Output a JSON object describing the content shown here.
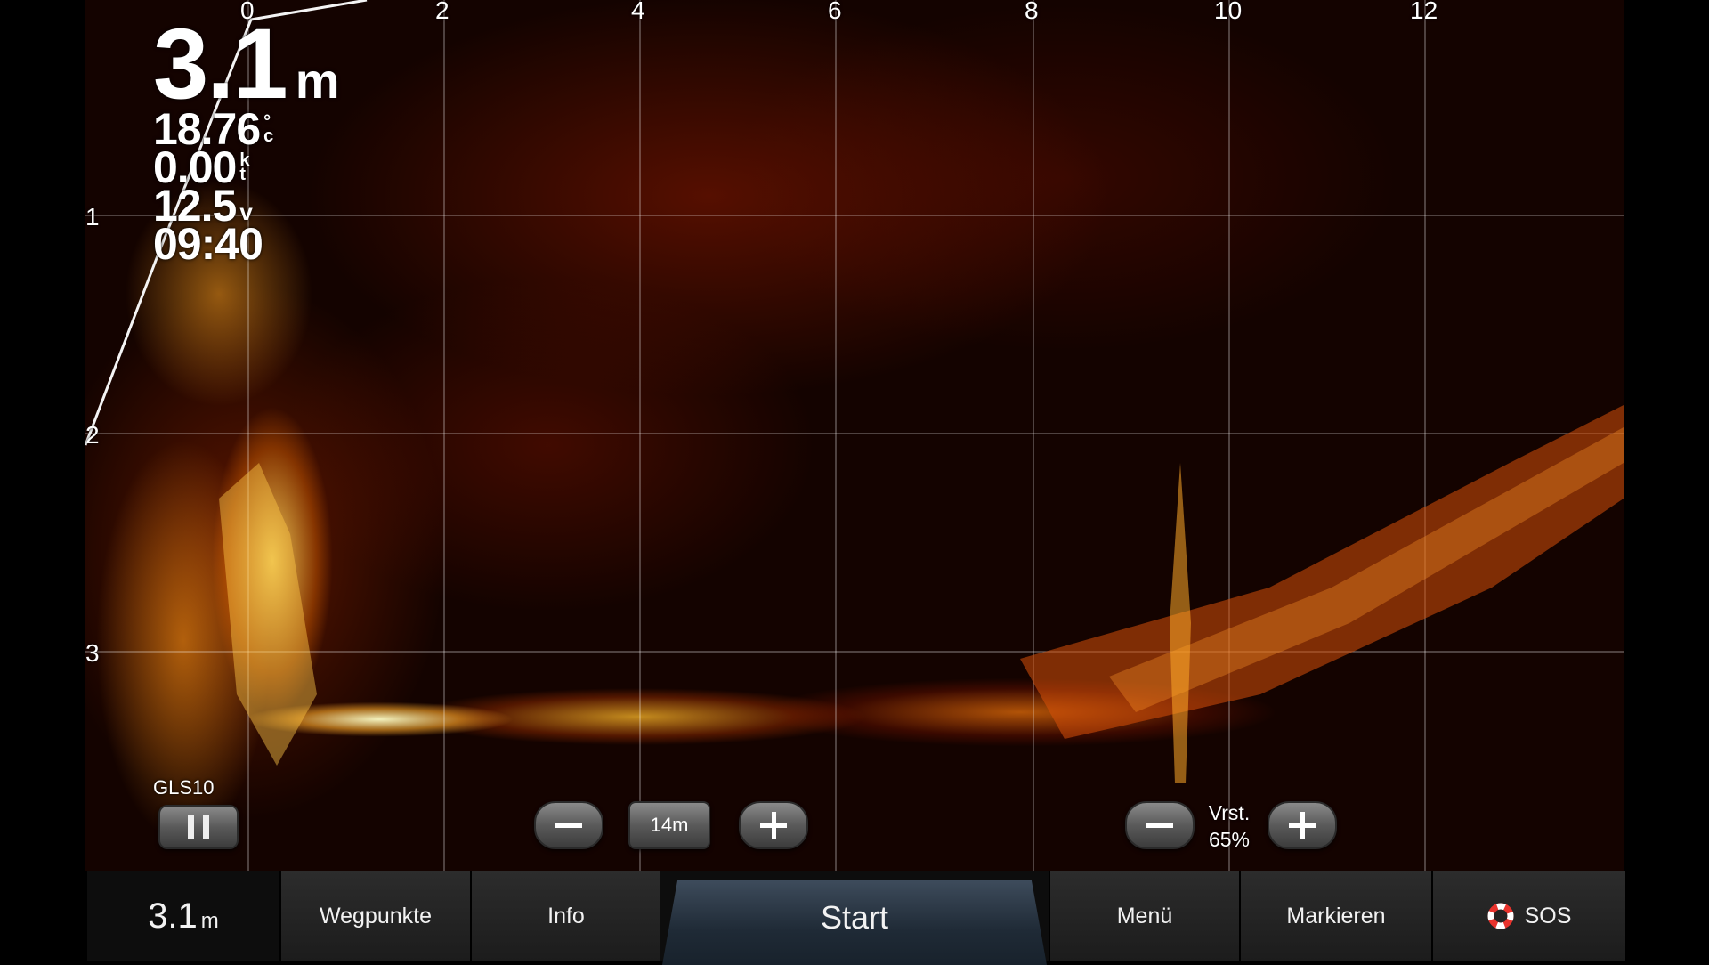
{
  "sonar": {
    "top_axis_labels": [
      "0",
      "2",
      "4",
      "6",
      "8",
      "10",
      "12"
    ],
    "left_axis_labels": [
      "1",
      "2",
      "3"
    ]
  },
  "readouts": {
    "depth_value": "3.1",
    "depth_unit": "m",
    "temperature_value": "18.76",
    "temperature_unit_top": "°",
    "temperature_unit_bottom": "c",
    "speed_value": "0.00",
    "speed_unit_top": "k",
    "speed_unit_bottom": "t",
    "voltage_value": "12.5",
    "voltage_unit": "v",
    "time_value": "09:40"
  },
  "controls": {
    "source_label": "GLS10",
    "range_value": "14m",
    "gain_label": "Vrst.",
    "gain_value": "65%"
  },
  "bottom_bar": {
    "depth_value": "3.1",
    "depth_unit": "m",
    "waypoints_label": "Wegpunkte",
    "info_label": "Info",
    "start_label": "Start",
    "menu_label": "Menü",
    "mark_label": "Markieren",
    "sos_label": "SOS"
  },
  "colors": {
    "sonar_background": "#140300",
    "sonar_hot": "#ffe066",
    "sonar_warm": "#c43200",
    "bar_background": "#1c1c1c",
    "start_tab": "#2b3a4a",
    "sos_icon": "#e8322c"
  },
  "icons": {
    "pause": "pause-icon",
    "minus": "minus-icon",
    "plus": "plus-icon",
    "sos": "lifebuoy-icon"
  }
}
